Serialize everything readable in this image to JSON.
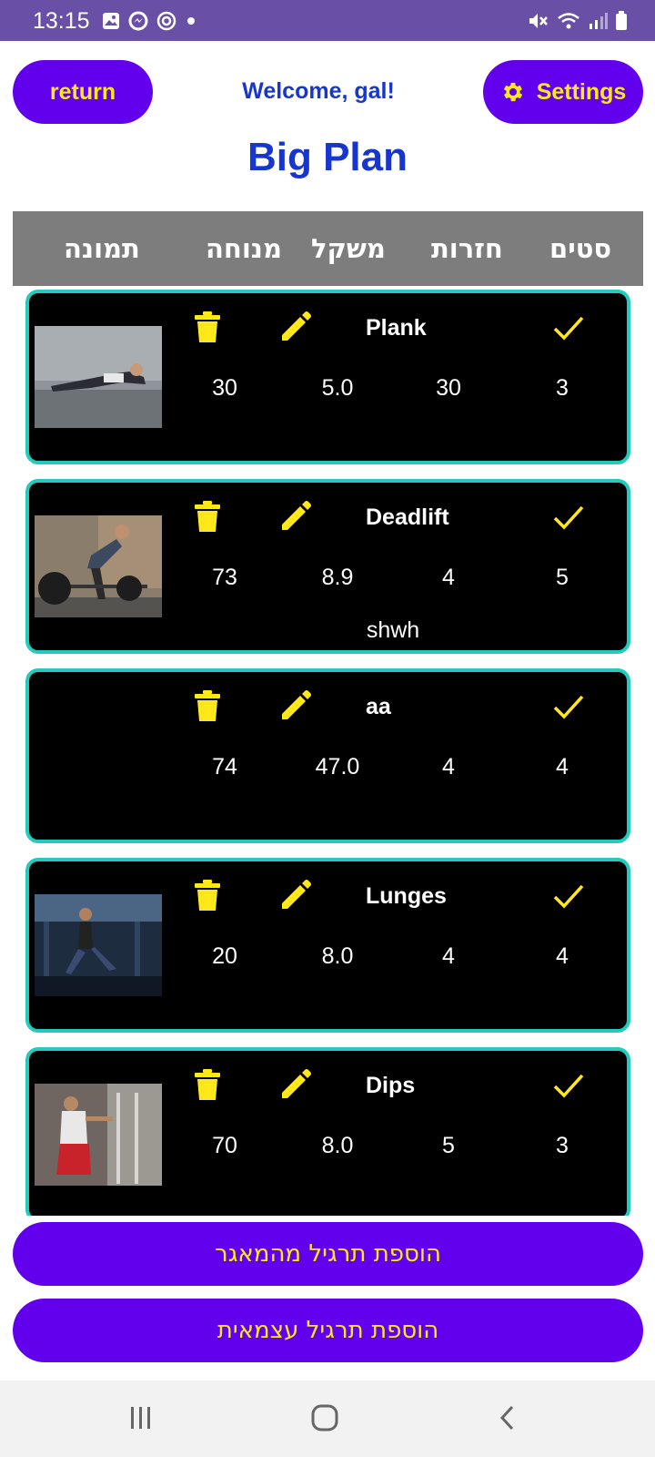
{
  "status_bar": {
    "time": "13:15",
    "left_icons": [
      "gallery-icon",
      "messenger-icon",
      "app-notification-icon",
      "dot-icon"
    ],
    "right_icons": [
      "mute-icon",
      "wifi-icon",
      "signal-icon",
      "battery-icon"
    ]
  },
  "header": {
    "return_label": "return",
    "welcome": "Welcome, gal!",
    "settings_label": "Settings",
    "title": "Big Plan"
  },
  "table_header": {
    "sets": "סטים",
    "reps": "חזרות",
    "weight": "משקל",
    "rest": "מנוחה",
    "image": "תמונה"
  },
  "exercises": [
    {
      "name": "Plank",
      "rest": "30",
      "weight": "5.0",
      "reps": "30",
      "sets": "3",
      "note": "",
      "has_image": true
    },
    {
      "name": "Deadlift",
      "rest": "73",
      "weight": "8.9",
      "reps": "4",
      "sets": "5",
      "note": "shwh",
      "has_image": true
    },
    {
      "name": "aa",
      "rest": "74",
      "weight": "47.0",
      "reps": "4",
      "sets": "4",
      "note": "",
      "has_image": false
    },
    {
      "name": "Lunges",
      "rest": "20",
      "weight": "8.0",
      "reps": "4",
      "sets": "4",
      "note": "",
      "has_image": true
    },
    {
      "name": "Dips",
      "rest": "70",
      "weight": "8.0",
      "reps": "5",
      "sets": "3",
      "note": "",
      "has_image": true
    }
  ],
  "buttons": {
    "add_from_library": "הוספת תרגיל מהמאגר",
    "add_custom": "הוספת תרגיל עצמאית"
  },
  "nav_bar": {
    "icons": [
      "recent-apps-icon",
      "home-icon",
      "back-icon"
    ]
  },
  "colors": {
    "status_bar": "#6a4fa6",
    "accent_purple": "#6200ee",
    "accent_yellow": "#ffe81a",
    "title_blue": "#1736d0",
    "card_border": "#21cbbd",
    "table_header_bg": "#7d7d7d"
  }
}
